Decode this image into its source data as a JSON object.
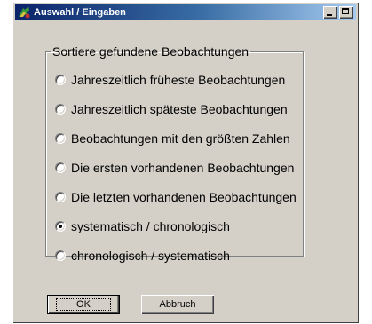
{
  "window": {
    "title": "Auswahl / Eingaben",
    "icon": "app-icon"
  },
  "group": {
    "legend": "Sortiere gefundene Beobachtungen",
    "options": [
      {
        "label": "Jahreszeitlich früheste Beobachtungen",
        "checked": false
      },
      {
        "label": "Jahreszeitlich späteste Beobachtungen",
        "checked": false
      },
      {
        "label": "Beobachtungen mit den größten Zahlen",
        "checked": false
      },
      {
        "label": "Die ersten vorhandenen Beobachtungen",
        "checked": false
      },
      {
        "label": "Die letzten vorhandenen Beobachtungen",
        "checked": false
      },
      {
        "label": "systematisch / chronologisch",
        "checked": true
      },
      {
        "label": "chronologisch / systematisch",
        "checked": false
      }
    ]
  },
  "buttons": {
    "ok": "OK",
    "cancel": "Abbruch"
  }
}
